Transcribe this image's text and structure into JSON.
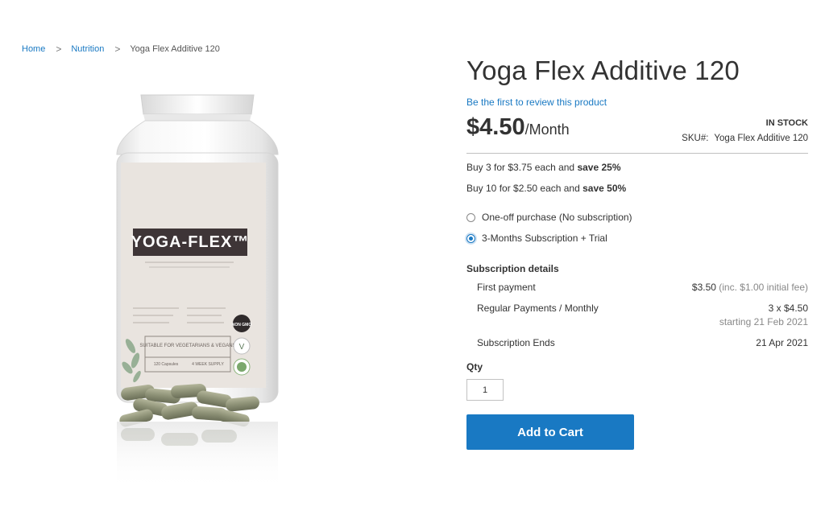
{
  "breadcrumb": {
    "home": "Home",
    "category": "Nutrition",
    "current": "Yoga Flex Additive 120",
    "separator": ">"
  },
  "product": {
    "title": "Yoga Flex Additive 120",
    "review_link": "Be the first to review this product",
    "price": "$4.50",
    "price_unit": "/Month",
    "stock": "IN STOCK",
    "sku_label": "SKU#:",
    "sku_value": "Yoga Flex Additive 120",
    "image_label": "YOGA-FLEX™",
    "image_tagline": "SUITABLE FOR VEGETARIANS & VEGANS",
    "image_caps": "120 Capsules",
    "image_supply": "4 WEEK SUPPLY",
    "image_badge": "NON GMO"
  },
  "tier_prices": [
    {
      "prefix": "Buy 3 for $3.75 each and ",
      "save": "save 25%"
    },
    {
      "prefix": "Buy 10 for $2.50 each and ",
      "save": "save 50%"
    }
  ],
  "purchase_options": [
    {
      "label": "One-off purchase (No subscription)",
      "checked": false
    },
    {
      "label": "3-Months Subscription + Trial",
      "checked": true
    }
  ],
  "subscription": {
    "heading": "Subscription details",
    "first_payment_label": "First payment",
    "first_payment_value": "$3.50",
    "first_payment_note": "(inc. $1.00 initial fee)",
    "regular_label": "Regular Payments / Monthly",
    "regular_value": "3 x $4.50",
    "regular_note": "starting 21 Feb 2021",
    "ends_label": "Subscription Ends",
    "ends_value": "21 Apr 2021"
  },
  "qty": {
    "label": "Qty",
    "value": "1"
  },
  "cart": {
    "button_label": "Add to Cart"
  },
  "colors": {
    "accent": "#1979c3",
    "text": "#333333",
    "muted": "#888888"
  }
}
